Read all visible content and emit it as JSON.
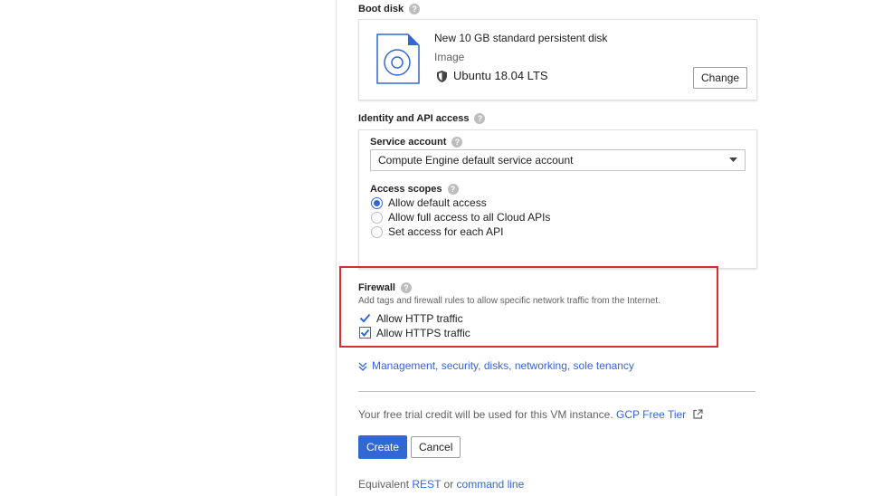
{
  "boot_disk": {
    "label": "Boot disk",
    "disk_name": "New 10 GB standard persistent disk",
    "image_label": "Image",
    "image_name": "Ubuntu 18.04 LTS",
    "change_label": "Change"
  },
  "identity": {
    "label": "Identity and API access",
    "service_account_label": "Service account",
    "service_account_value": "Compute Engine default service account",
    "access_scopes_label": "Access scopes",
    "scopes": [
      {
        "label": "Allow default access",
        "selected": true
      },
      {
        "label": "Allow full access to all Cloud APIs",
        "selected": false
      },
      {
        "label": "Set access for each API",
        "selected": false
      }
    ]
  },
  "firewall": {
    "label": "Firewall",
    "description": "Add tags and firewall rules to allow specific network traffic from the Internet.",
    "options": [
      {
        "label": "Allow HTTP traffic",
        "checked": true
      },
      {
        "label": "Allow HTTPS traffic",
        "checked": true
      }
    ]
  },
  "management_link": "Management, security, disks, networking, sole tenancy",
  "trial": {
    "text": "Your free trial credit will be used for this VM instance.",
    "link": "GCP Free Tier"
  },
  "actions": {
    "create_label": "Create",
    "cancel_label": "Cancel"
  },
  "equivalent": {
    "prefix": "Equivalent",
    "rest": "REST",
    "or": "or",
    "command_line": "command line"
  },
  "colors": {
    "accent": "#3367d6",
    "highlight": "#d32f2f"
  }
}
